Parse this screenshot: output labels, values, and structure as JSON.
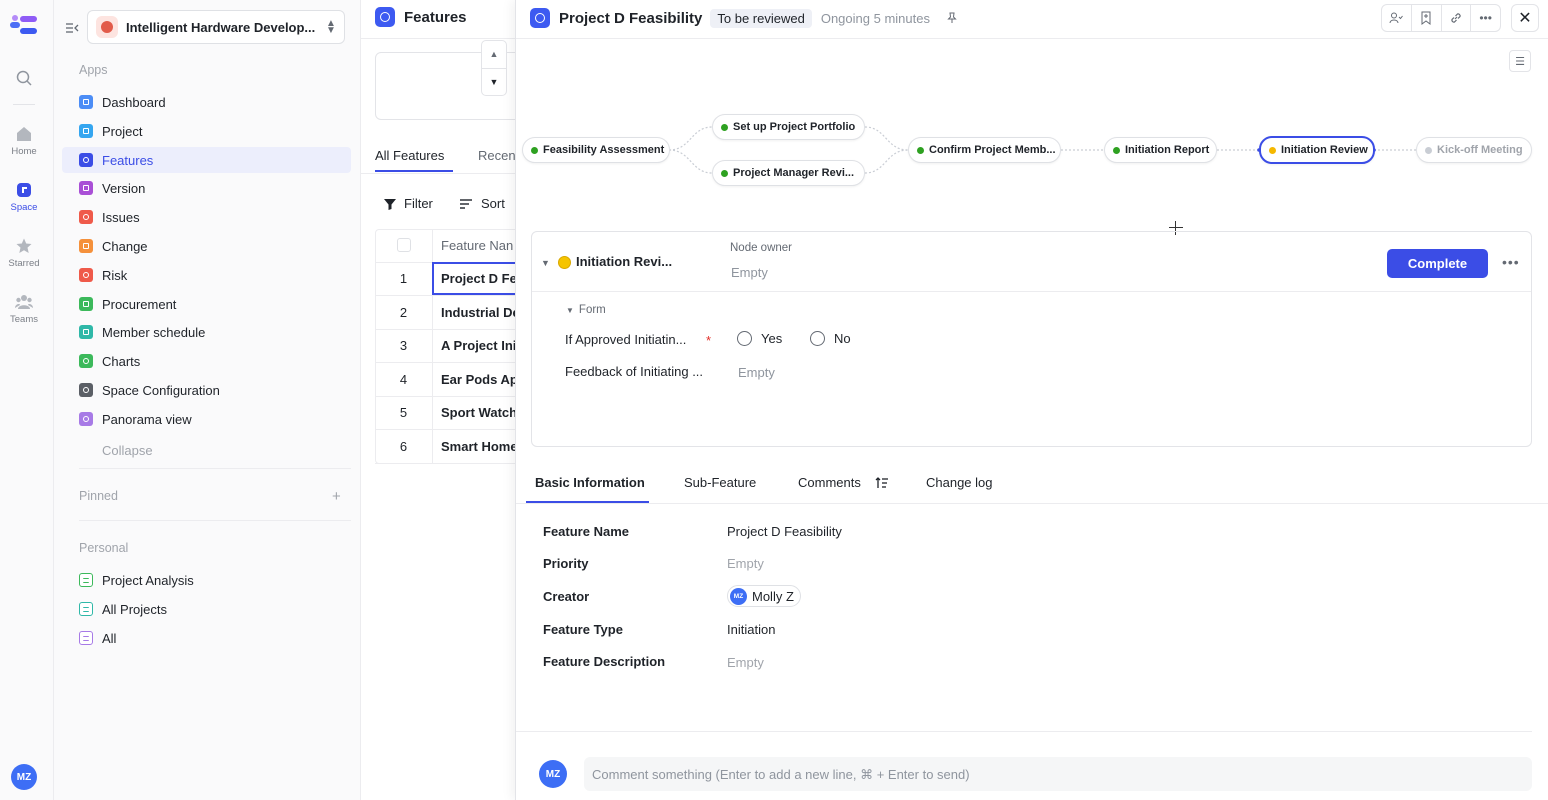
{
  "rail": {
    "items": [
      {
        "label": "Home"
      },
      {
        "label": "Space"
      },
      {
        "label": "Starred"
      },
      {
        "label": "Teams"
      }
    ],
    "avatar": "MZ"
  },
  "sidebar": {
    "workspace": "Intelligent Hardware Develop...",
    "apps_title": "Apps",
    "apps": [
      {
        "label": "Dashboard",
        "color": "#4c8df6"
      },
      {
        "label": "Project",
        "color": "#35a6f0"
      },
      {
        "label": "Features",
        "color": "#3b4de6"
      },
      {
        "label": "Version",
        "color": "#a94fd6"
      },
      {
        "label": "Issues",
        "color": "#ef5a4a"
      },
      {
        "label": "Change",
        "color": "#f5913b"
      },
      {
        "label": "Risk",
        "color": "#ef5a4a"
      },
      {
        "label": "Procurement",
        "color": "#3cb95b"
      },
      {
        "label": "Member schedule",
        "color": "#2fb8a8"
      },
      {
        "label": "Charts",
        "color": "#3cb95b"
      },
      {
        "label": "Space Configuration",
        "color": "#5b5f66"
      },
      {
        "label": "Panorama view",
        "color": "#a77ae6"
      }
    ],
    "collapse": "Collapse",
    "pinned_title": "Pinned",
    "personal_title": "Personal",
    "personal": [
      {
        "label": "Project Analysis",
        "color": "#3cb95b"
      },
      {
        "label": "All Projects",
        "color": "#2fb8a8"
      },
      {
        "label": "All",
        "color": "#a77ae6"
      }
    ]
  },
  "list": {
    "title": "Features",
    "tab_all": "All Features",
    "tab_recent": "Recen",
    "filter": "Filter",
    "sort": "Sort",
    "col_name": "Feature Nan",
    "rows": [
      {
        "no": "1",
        "name": "Project D Fe"
      },
      {
        "no": "2",
        "name": "Industrial De"
      },
      {
        "no": "3",
        "name": "A Project Ini"
      },
      {
        "no": "4",
        "name": "Ear Pods Ap"
      },
      {
        "no": "5",
        "name": "Sport Watch"
      },
      {
        "no": "6",
        "name": "Smart Home"
      }
    ]
  },
  "detail": {
    "title": "Project D Feasibility",
    "badge": "To be reviewed",
    "status": "Ongoing 5 minutes",
    "flow": [
      {
        "label": "Feasibility Assessment",
        "state": "done"
      },
      {
        "label": "Set up Project Portfolio",
        "state": "done"
      },
      {
        "label": "Project Manager Revi...",
        "state": "done"
      },
      {
        "label": "Confirm Project Memb...",
        "state": "done"
      },
      {
        "label": "Initiation Report",
        "state": "done"
      },
      {
        "label": "Initiation Review",
        "state": "active"
      },
      {
        "label": "Kick-off Meeting",
        "state": "future"
      }
    ],
    "node": {
      "name": "Initiation Revi...",
      "owner_label": "Node owner",
      "owner_value": "Empty",
      "complete": "Complete",
      "form_label": "Form",
      "field1": "If Approved Initiatin...",
      "opt_yes": "Yes",
      "opt_no": "No",
      "field2": "Feedback of Initiating ...",
      "field2_value": "Empty"
    },
    "tabs": [
      "Basic Information",
      "Sub-Feature",
      "Comments",
      "Change log"
    ],
    "info": {
      "name_label": "Feature Name",
      "name_value": "Project D Feasibility",
      "priority_label": "Priority",
      "priority_value": "Empty",
      "creator_label": "Creator",
      "creator_initials": "MZ",
      "creator_value": "Molly Z",
      "type_label": "Feature Type",
      "type_value": "Initiation",
      "desc_label": "Feature Description",
      "desc_value": "Empty"
    },
    "comment_avatar": "MZ",
    "comment_placeholder": "Comment something (Enter to add a new line, ⌘ + Enter to send)"
  }
}
